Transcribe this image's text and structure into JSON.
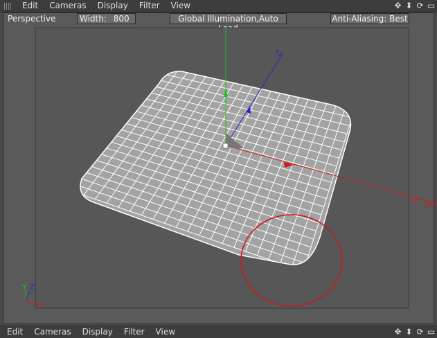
{
  "top_menu": {
    "items": [
      "Edit",
      "Cameras",
      "Display",
      "Filter",
      "View"
    ]
  },
  "bottom_menu": {
    "items": [
      "Edit",
      "Cameras",
      "Display",
      "Filter",
      "View"
    ]
  },
  "viewport": {
    "view_name": "Perspective",
    "width_label": "Width:",
    "width_value": "800",
    "gi_label": "Global Illumination,Auto Load",
    "aa_label": "Anti-Aliasing: Best"
  },
  "axis_labels": {
    "z": "Z",
    "y": "Y",
    "x": "X"
  },
  "nav_icons": [
    "move-icon",
    "scale-icon",
    "rotate-icon",
    "maximize-icon"
  ],
  "colors": {
    "x_axis": "#d02020",
    "y_axis": "#20c020",
    "z_axis": "#2020c0",
    "highlight_circle": "#cc1a1a",
    "grid_surface": "#a8a8a8"
  }
}
